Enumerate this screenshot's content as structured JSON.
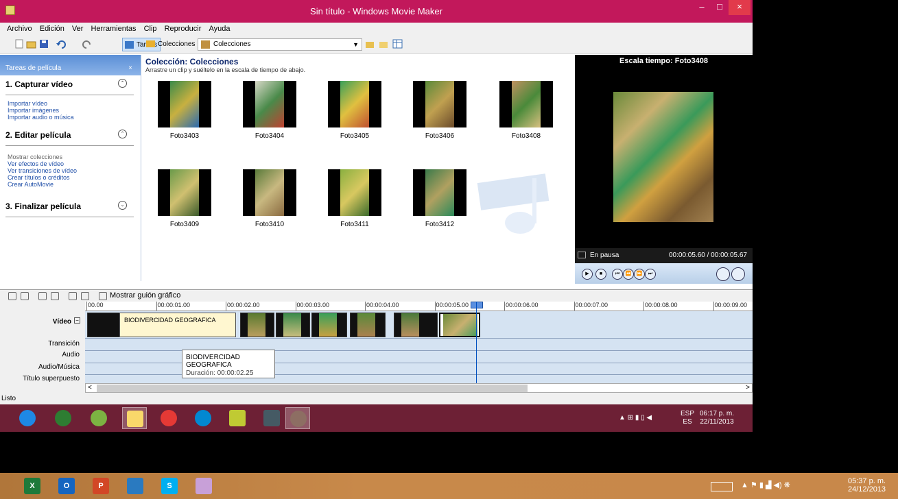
{
  "window": {
    "title": "Sin título - Windows Movie Maker",
    "minimize": "–",
    "maximize": "□",
    "close": "×"
  },
  "menu": [
    "Archivo",
    "Edición",
    "Ver",
    "Herramientas",
    "Clip",
    "Reproducir",
    "Ayuda"
  ],
  "toolbar": {
    "tasks_label": "Tareas",
    "collections_label": "Colecciones",
    "collection_select": "Colecciones",
    "icons": [
      "new-project-icon",
      "open-icon",
      "save-icon",
      "undo-icon",
      "redo-icon",
      "up-folder-icon",
      "new-folder-icon",
      "views-icon"
    ]
  },
  "tasks_pane": {
    "header": "Tareas de película",
    "close": "×",
    "sections": [
      {
        "title": "1. Capturar vídeo",
        "toggle": "⌃",
        "links": [
          "Importar vídeo",
          "Importar imágenes",
          "Importar audio o música"
        ]
      },
      {
        "title": "2. Editar película",
        "toggle": "⌃",
        "links": [
          "Mostrar colecciones",
          "Ver efectos de vídeo",
          "Ver transiciones de vídeo",
          "Crear títulos o créditos",
          "Crear AutoMovie"
        ]
      },
      {
        "title": "3. Finalizar película",
        "toggle": "⌄",
        "links": []
      }
    ]
  },
  "collection": {
    "title": "Colección: Colecciones",
    "subtitle": "Arrastre un clip y suéltelo en la escala de tiempo de abajo.",
    "items": [
      "Foto3403",
      "Foto3404",
      "Foto3405",
      "Foto3406",
      "Foto3408",
      "Foto3409",
      "Foto3410",
      "Foto3411",
      "Foto3412"
    ]
  },
  "preview": {
    "title": "Escala tiempo: Foto3408",
    "status": "En pausa",
    "time": "00:00:05.60 / 00:00:05.67",
    "buttons": [
      "▶",
      "■",
      "⏮",
      "⏪",
      "⏩",
      "⏭"
    ]
  },
  "timeline": {
    "storyboard_label": "Mostrar guión gráfico",
    "ruler": [
      "00.00",
      "00:00:01.00",
      "00:00:02.00",
      "00:00:03.00",
      "00:00:04.00",
      "00:00:05.00",
      "00:00:06.00",
      "00:00:07.00",
      "00:00:08.00",
      "00:00:09.00"
    ],
    "tracks": [
      "Vídeo",
      "Transición",
      "Audio",
      "Audio/Música",
      "Título superpuesto"
    ],
    "title_clip": "BIODIVERCIDAD GEOGRAFICA",
    "tooltip_title": "BIODIVERCIDAD GEOGRAFICA",
    "tooltip_duration": "Duración: 00:00:02.25",
    "scroll_left": "<",
    "scroll_right": ">"
  },
  "status": "Listo",
  "inner_taskbar": {
    "apps": [
      "ie-icon",
      "media-center-icon",
      "itunes-icon",
      "file-explorer-icon",
      "recorder-icon",
      "media-player-icon",
      "sticky-notes-icon",
      "movie-maker-taskbar-icon",
      "movie-maker-active-icon"
    ],
    "lang_top": "ESP",
    "lang_bottom": "ES",
    "time": "06:17 p. m.",
    "date": "22/11/2013"
  },
  "outer_taskbar": {
    "apps": [
      {
        "name": "excel-icon",
        "text": "X",
        "color": "#1e7a3a"
      },
      {
        "name": "outlook-icon",
        "text": "O",
        "color": "#1565c0"
      },
      {
        "name": "powerpoint-icon",
        "text": "P",
        "color": "#d24726"
      },
      {
        "name": "disc-icon",
        "text": "",
        "color": "#2a7ac0"
      },
      {
        "name": "skype-icon",
        "text": "S",
        "color": "#00aff0"
      },
      {
        "name": "paint-icon",
        "text": "",
        "color": "#c8a0d8"
      }
    ],
    "time": "05:37 p. m.",
    "date": "24/12/2013"
  }
}
